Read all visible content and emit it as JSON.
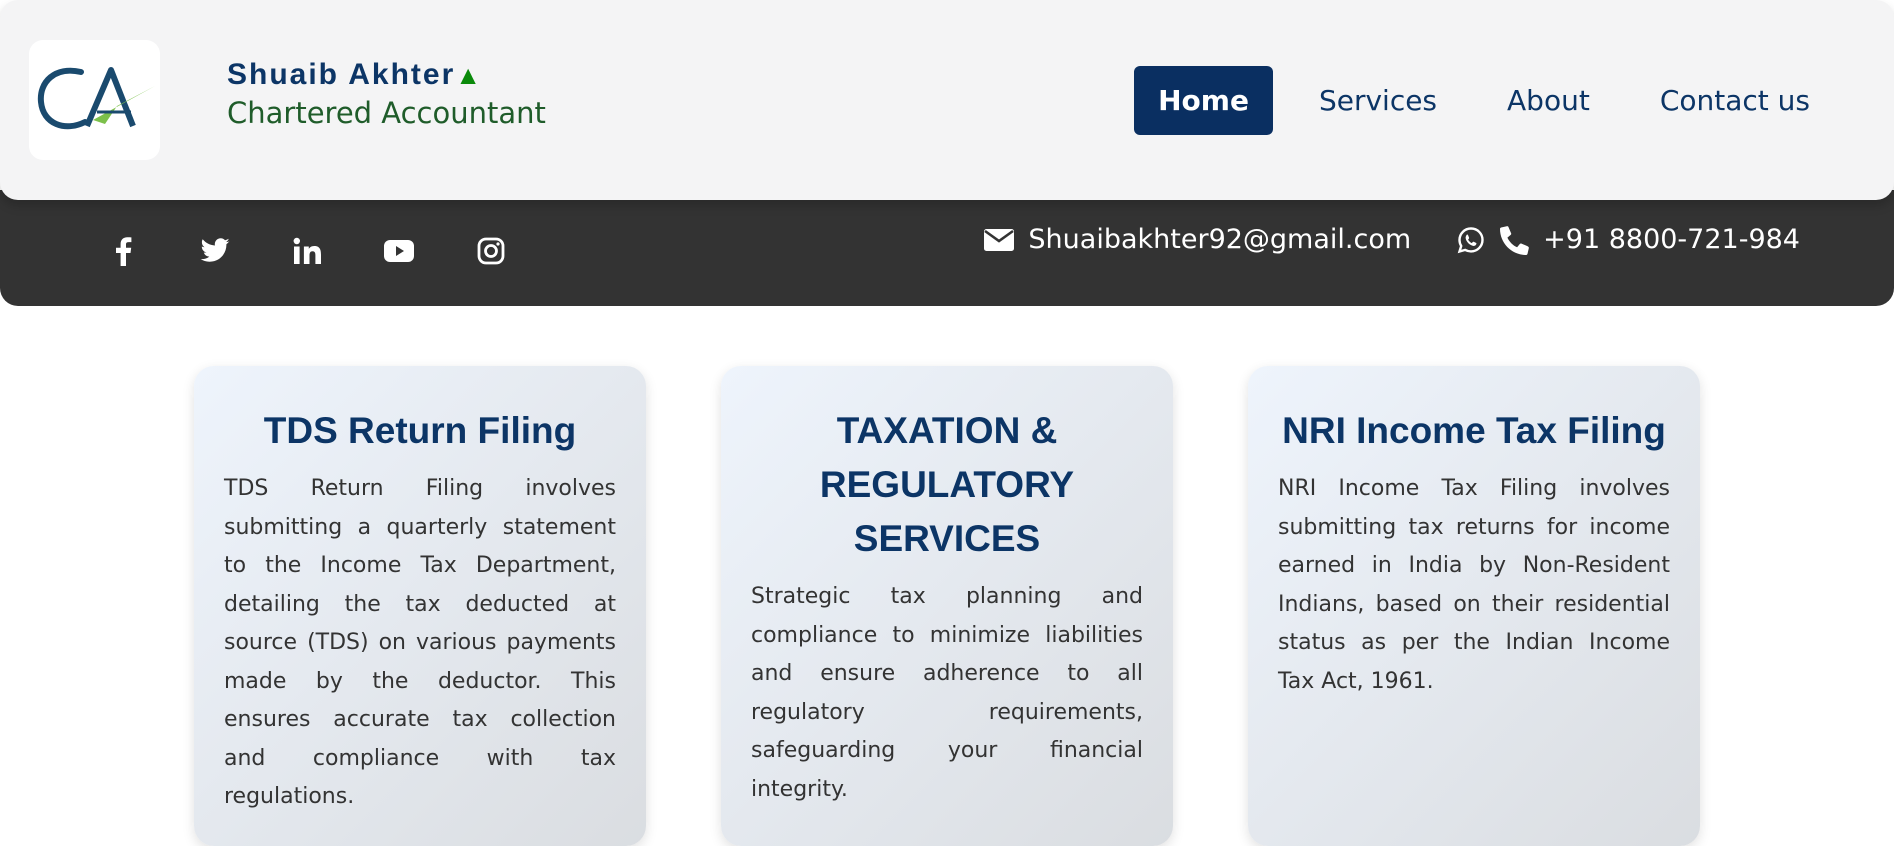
{
  "brand": {
    "name": "Shuaib Akhter",
    "triangle": "▲",
    "subtitle": "Chartered Accountant",
    "logo_icon": "ca-logo-icon",
    "colors": {
      "navy": "#0c3566",
      "green": "#1f5c2a",
      "accent": "#7cc04b"
    }
  },
  "nav": {
    "items": [
      {
        "label": "Home",
        "active": true
      },
      {
        "label": "Services",
        "active": false
      },
      {
        "label": "About",
        "active": false
      },
      {
        "label": "Contact us",
        "active": false
      }
    ]
  },
  "topbar": {
    "social_icons": [
      "facebook-icon",
      "twitter-icon",
      "linkedin-icon",
      "youtube-icon",
      "instagram-icon"
    ],
    "email": "Shuaibakhter92@gmail.com",
    "phone": "+91 8800-721-984",
    "background": "#333333"
  },
  "cards": [
    {
      "title": "TDS Return Filing",
      "text": "TDS Return Filing involves submitting a quarterly statement to the Income Tax Department, detailing the tax deducted at source (TDS) on various payments made by the deductor. This ensures accurate tax collection and compliance with tax regulations."
    },
    {
      "title": "TAXATION & REGULATORY SERVICES",
      "text": "Strategic tax planning and compliance to minimize liabilities and ensure adherence to all regulatory requirements, safeguarding your financial integrity."
    },
    {
      "title": "NRI Income Tax Filing",
      "text": "NRI Income Tax Filing involves submitting tax returns for income earned in India by Non-Resident Indians, based on their residential status as per the Indian Income Tax Act, 1961."
    }
  ]
}
